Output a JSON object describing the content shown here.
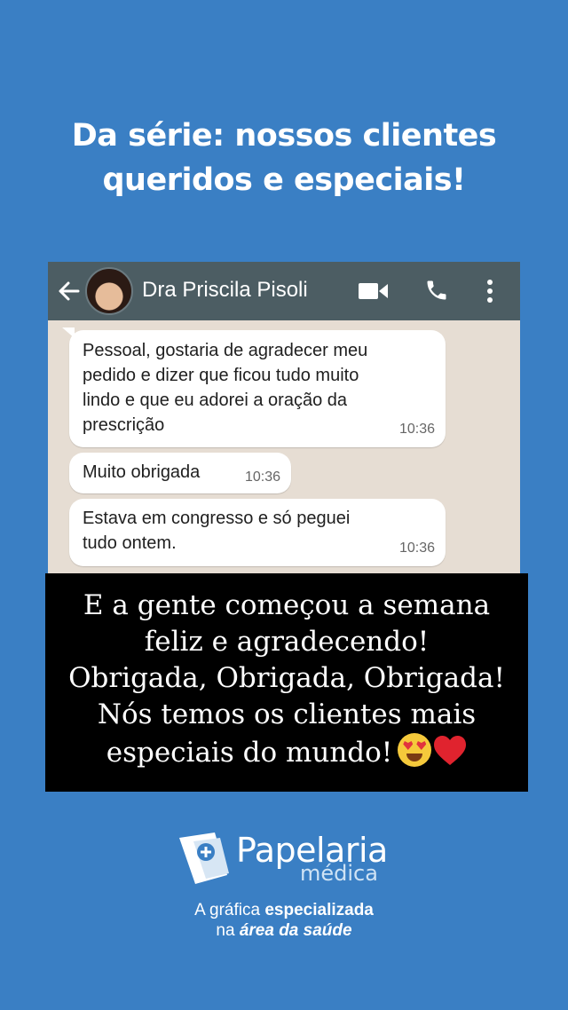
{
  "headline": {
    "line1": "Da série: nossos clientes",
    "line2": "queridos e especiais!"
  },
  "chat": {
    "contact_name": "Dra Priscila Pisoli",
    "messages": [
      {
        "lines": [
          "Pessoal, gostaria de agradecer meu",
          "pedido e dizer que ficou tudo muito",
          "lindo e que eu adorei a oração da",
          "prescrição"
        ],
        "time": "10:36"
      },
      {
        "lines": [
          "Muito obrigada"
        ],
        "time": "10:36"
      },
      {
        "lines": [
          "Estava em congresso e só peguei",
          "tudo ontem."
        ],
        "time": "10:36"
      }
    ]
  },
  "caption": {
    "line1": "E a gente começou a semana",
    "line2": "feliz e  agradecendo!",
    "line3": "Obrigada, Obrigada, Obrigada!",
    "line4": "Nós temos os clientes mais",
    "line5": "especiais do mundo!"
  },
  "brand": {
    "name1": "Papelaria",
    "name2": "médica",
    "tagline_a": "A gráfica ",
    "tagline_b": "especializada",
    "tagline_c": "na ",
    "tagline_d": "área da saúde"
  },
  "colors": {
    "background": "#3a7fc4",
    "chat_header": "#4c5d63",
    "chat_wallpaper": "#e6ddd3"
  },
  "icons": [
    "back-arrow-icon",
    "video-call-icon",
    "phone-icon",
    "more-menu-icon",
    "heart-eyes-emoji-icon",
    "red-heart-emoji-icon",
    "logo-icon"
  ]
}
